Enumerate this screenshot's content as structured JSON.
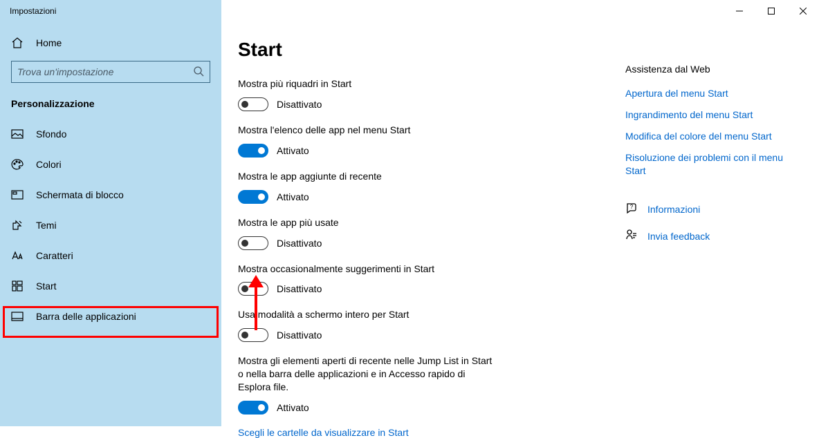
{
  "window": {
    "title": "Impostazioni"
  },
  "sidebar": {
    "home": "Home",
    "search_placeholder": "Trova un'impostazione",
    "section": "Personalizzazione",
    "items": [
      {
        "label": "Sfondo"
      },
      {
        "label": "Colori"
      },
      {
        "label": "Schermata di blocco"
      },
      {
        "label": "Temi"
      },
      {
        "label": "Caratteri"
      },
      {
        "label": "Start"
      },
      {
        "label": "Barra delle applicazioni"
      }
    ]
  },
  "page": {
    "title": "Start",
    "settings": [
      {
        "label": "Mostra più riquadri in Start",
        "on": false
      },
      {
        "label": "Mostra l'elenco delle app nel menu Start",
        "on": true
      },
      {
        "label": "Mostra le app aggiunte di recente",
        "on": true
      },
      {
        "label": "Mostra le app più usate",
        "on": false
      },
      {
        "label": "Mostra occasionalmente suggerimenti in Start",
        "on": false
      },
      {
        "label": "Usa modalità a schermo intero per Start",
        "on": false
      },
      {
        "label": "Mostra gli elementi aperti di recente nelle Jump List in Start o nella barra delle applicazioni e in Accesso rapido di Esplora file.",
        "on": true
      }
    ],
    "status_on": "Attivato",
    "status_off": "Disattivato",
    "choose_folders": "Scegli le cartelle da visualizzare in Start"
  },
  "aside": {
    "header": "Assistenza dal Web",
    "links": [
      "Apertura del menu Start",
      "Ingrandimento del menu Start",
      "Modifica del colore del menu Start",
      "Risoluzione dei problemi con il menu Start"
    ],
    "help": "Informazioni",
    "feedback": "Invia feedback"
  }
}
